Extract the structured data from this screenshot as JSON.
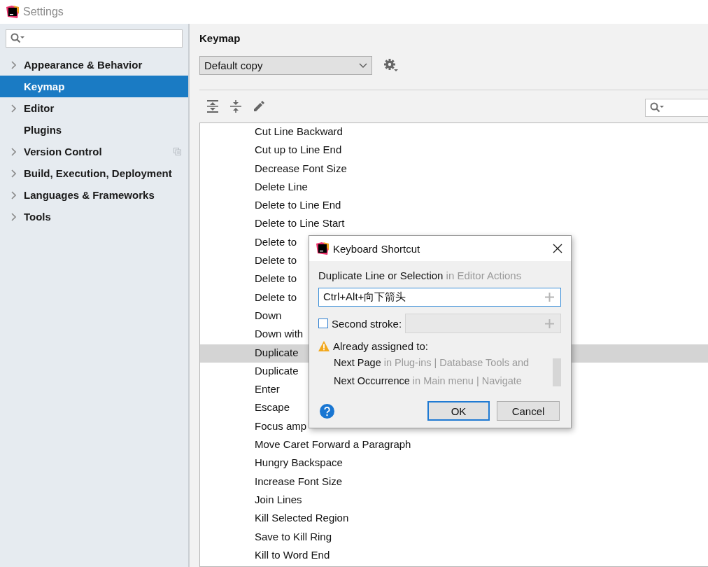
{
  "window": {
    "title": "Settings"
  },
  "sidebar": {
    "items": [
      {
        "label": "Appearance & Behavior",
        "expandable": true,
        "selected": false,
        "project_level": false
      },
      {
        "label": "Keymap",
        "expandable": false,
        "selected": true,
        "project_level": false
      },
      {
        "label": "Editor",
        "expandable": true,
        "selected": false,
        "project_level": false
      },
      {
        "label": "Plugins",
        "expandable": false,
        "selected": false,
        "project_level": false
      },
      {
        "label": "Version Control",
        "expandable": true,
        "selected": false,
        "project_level": true
      },
      {
        "label": "Build, Execution, Deployment",
        "expandable": true,
        "selected": false,
        "project_level": false
      },
      {
        "label": "Languages & Frameworks",
        "expandable": true,
        "selected": false,
        "project_level": false
      },
      {
        "label": "Tools",
        "expandable": true,
        "selected": false,
        "project_level": false
      }
    ]
  },
  "keymap": {
    "title": "Keymap",
    "scheme": "Default copy",
    "actions": [
      {
        "label": "Cut Line Backward",
        "selected": false
      },
      {
        "label": "Cut up to Line End",
        "selected": false
      },
      {
        "label": "Decrease Font Size",
        "selected": false
      },
      {
        "label": "Delete Line",
        "selected": false
      },
      {
        "label": "Delete to Line End",
        "selected": false
      },
      {
        "label": "Delete to Line Start",
        "selected": false
      },
      {
        "label": "Delete to",
        "selected": false
      },
      {
        "label": "Delete to",
        "selected": false
      },
      {
        "label": "Delete to",
        "selected": false
      },
      {
        "label": "Delete to",
        "selected": false
      },
      {
        "label": "Down",
        "selected": false
      },
      {
        "label": "Down with",
        "selected": false
      },
      {
        "label": "Duplicate",
        "selected": true
      },
      {
        "label": "Duplicate",
        "selected": false
      },
      {
        "label": "Enter",
        "selected": false
      },
      {
        "label": "Escape",
        "selected": false
      },
      {
        "label": "Focus amp",
        "selected": false
      },
      {
        "label": "Move Caret Forward a Paragraph",
        "selected": false
      },
      {
        "label": "Hungry Backspace",
        "selected": false
      },
      {
        "label": "Increase Font Size",
        "selected": false
      },
      {
        "label": "Join Lines",
        "selected": false
      },
      {
        "label": "Kill Selected Region",
        "selected": false
      },
      {
        "label": "Save to Kill Ring",
        "selected": false
      },
      {
        "label": "Kill to Word End",
        "selected": false
      }
    ]
  },
  "dialog": {
    "title": "Keyboard Shortcut",
    "action": "Duplicate Line or Selection",
    "context": "in Editor Actions",
    "first_stroke": "Ctrl+Alt+向下箭头",
    "second_stroke": {
      "label": "Second stroke:",
      "checked": false
    },
    "conflicts_title": "Already assigned to:",
    "conflicts": [
      {
        "action": "Next Page",
        "context": "in Plug-ins | Database Tools and"
      },
      {
        "action": "Next Occurrence",
        "context": "in Main menu | Navigate"
      }
    ],
    "buttons": [
      {
        "label": "OK",
        "default": true
      },
      {
        "label": "Cancel",
        "default": false
      }
    ]
  }
}
